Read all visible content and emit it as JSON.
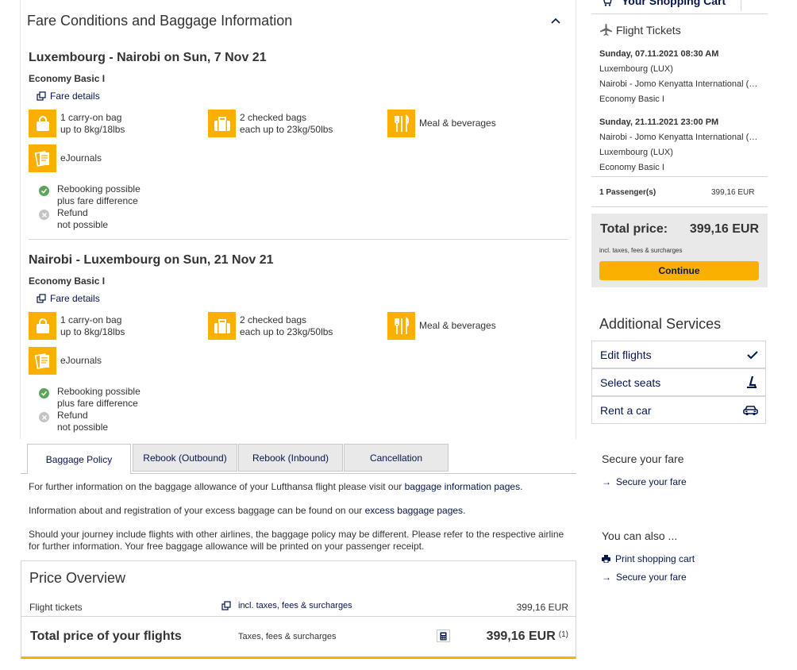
{
  "fare_section": {
    "title": "Fare Conditions and Baggage Information",
    "flights": [
      {
        "route": "Luxembourg - Nairobi on Sun, 7 Nov 21",
        "fare_class": "Economy Basic I",
        "fare_details": "Fare details",
        "carry_on": [
          "1 carry-on bag",
          "up to 8kg/18lbs"
        ],
        "checked": [
          "2 checked bags",
          "each up to 23kg/50lbs"
        ],
        "meal": "Meal & beverages",
        "ejournals": "eJournals",
        "rebooking": [
          "Rebooking possible",
          "plus fare difference"
        ],
        "refund": [
          "Refund",
          "not possible"
        ]
      },
      {
        "route": "Nairobi - Luxembourg on Sun, 21 Nov 21",
        "fare_class": "Economy Basic I",
        "fare_details": "Fare details",
        "carry_on": [
          "1 carry-on bag",
          "up to 8kg/18lbs"
        ],
        "checked": [
          "2 checked bags",
          "each up to 23kg/50lbs"
        ],
        "meal": "Meal & beverages",
        "ejournals": "eJournals",
        "rebooking": [
          "Rebooking possible",
          "plus fare difference"
        ],
        "refund": [
          "Refund",
          "not possible"
        ]
      }
    ],
    "tabs": [
      "Baggage Policy",
      "Rebook (Outbound)",
      "Rebook (Inbound)",
      "Cancellation"
    ],
    "policy": {
      "p1_text": "For further information on the baggage allowance of your Lufthansa flight please visit our ",
      "p1_link": "baggage information pages",
      "p1_end": ".",
      "p2_text": "Information about and registration of your excess baggage can be found on our ",
      "p2_link": "excess baggage pages",
      "p2_end": ".",
      "p3": "Should your journey include flights with other airlines, the baggage policy may be different. Please refer to the respective airline for further information. Your free baggage allowance will be printed on your passenger receipt."
    }
  },
  "price_overview": {
    "title": "Price Overview",
    "flight_tickets_label": "Flight tickets",
    "incl_note": "incl. taxes, fees & surcharges",
    "tickets_amount": "399,16 EUR",
    "total_label": "Total price of your flights",
    "taxes_label": "Taxes, fees & surcharges",
    "total_amount": "399,16 EUR",
    "footnote": "(1)"
  },
  "cart": {
    "title": "Your Shopping Cart",
    "section": "Flight Tickets",
    "outbound": {
      "date": "Sunday, 07.11.2021 08:30 AM",
      "from": "Luxembourg (LUX)",
      "to": "Nairobi - Jomo Kenyatta International (…",
      "fare": "Economy Basic I"
    },
    "inbound": {
      "date": "Sunday, 21.11.2021 23:00 PM",
      "from": "Nairobi - Jomo Kenyatta International (…",
      "to": "Luxembourg (LUX)",
      "fare": "Economy Basic I"
    },
    "passengers": "1 Passenger(s)",
    "passengers_amount": "399,16 EUR",
    "total_label": "Total price:",
    "total_amount": "399,16 EUR",
    "total_note": "incl. taxes, fees & surcharges",
    "continue": "Continue"
  },
  "additional_services": {
    "title": "Additional Services",
    "items": [
      "Edit flights",
      "Select seats",
      "Rent a car"
    ]
  },
  "secure_fare": {
    "heading": "Secure your fare",
    "link": "Secure your fare"
  },
  "also": {
    "heading": "You can also ...",
    "print": "Print shopping cart",
    "secure": "Secure your fare"
  },
  "colors": {
    "accent": "#f9b000",
    "navy": "#05164d",
    "success": "#5aa55a",
    "muted": "#c4c4c4"
  }
}
